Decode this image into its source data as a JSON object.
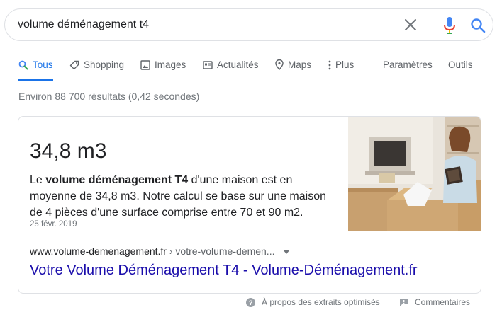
{
  "search": {
    "query": "volume déménagement t4"
  },
  "tabs": [
    {
      "label": "Tous",
      "icon": "search-icon",
      "active": true
    },
    {
      "label": "Shopping",
      "icon": "tag-icon"
    },
    {
      "label": "Images",
      "icon": "image-icon"
    },
    {
      "label": "Actualités",
      "icon": "news-icon"
    },
    {
      "label": "Maps",
      "icon": "map-pin-icon"
    },
    {
      "label": "Plus",
      "icon": "more-vert-icon"
    },
    {
      "label": "Paramètres"
    },
    {
      "label": "Outils"
    }
  ],
  "stats": "Environ 88 700 résultats (0,42 secondes)",
  "snippet": {
    "answer": "34,8 m3",
    "text_before": "Le ",
    "text_bold": "volume déménagement T4",
    "text_after": " d'une maison est en moyenne de 34,8 m3. Notre calcul se base sur une maison de 4 pièces d'une surface comprise entre 70 et 90 m2.",
    "date": "25 févr. 2019",
    "image": "woman-unpacking-moving-boxes-photo",
    "cite_domain": "www.volume-demenagement.fr",
    "cite_path": " › votre-volume-demen...",
    "title": "Votre Volume Déménagement T4 - Volume-Déménagement.fr"
  },
  "footer": {
    "help_label": "À propos des extraits optimisés",
    "feedback_label": "Commentaires"
  },
  "colors": {
    "accent": "#1a73e8",
    "link": "#1a0dab",
    "mic_blue": "#4285f4",
    "mic_red": "#ea4335",
    "mic_yellow": "#fbbc05",
    "mic_green": "#34a853"
  }
}
